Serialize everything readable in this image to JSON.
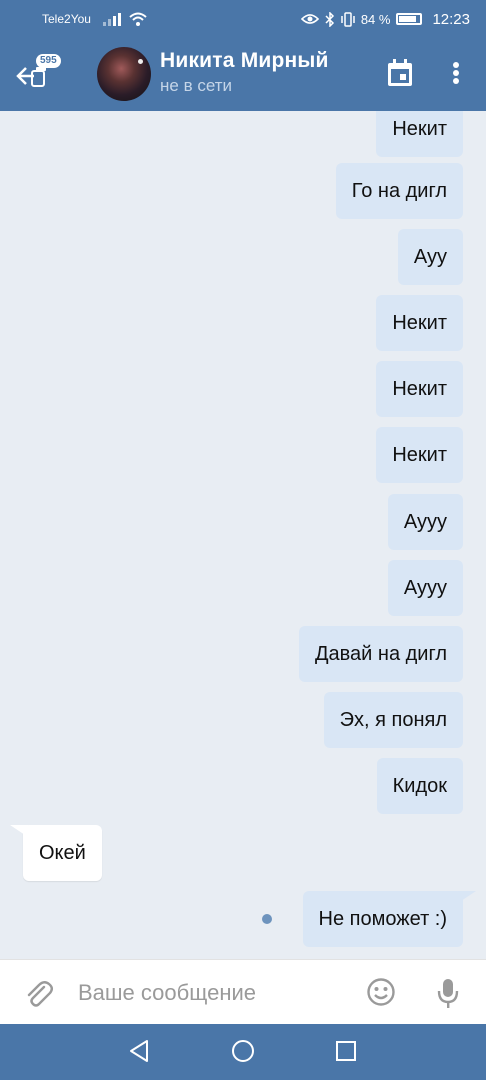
{
  "status_bar": {
    "carrier": "Tele2You",
    "battery": "84 %",
    "battery_level": 0.84,
    "time": "12:23"
  },
  "header": {
    "unread_count": "595",
    "contact_name": "Никита Мирный",
    "contact_status": "не в сети"
  },
  "messages": [
    {
      "dir": "out",
      "text": "Некит"
    },
    {
      "dir": "out",
      "text": "Го на дигл"
    },
    {
      "dir": "out",
      "text": "Ауу"
    },
    {
      "dir": "out",
      "text": "Некит"
    },
    {
      "dir": "out",
      "text": "Некит"
    },
    {
      "dir": "out",
      "text": "Некит"
    },
    {
      "dir": "out",
      "text": "Аууу"
    },
    {
      "dir": "out",
      "text": "Аууу"
    },
    {
      "dir": "out",
      "text": "Давай на дигл"
    },
    {
      "dir": "out",
      "text": "Эх, я понял"
    },
    {
      "dir": "out",
      "text": "Кидок"
    },
    {
      "dir": "in",
      "text": "Окей"
    },
    {
      "dir": "out",
      "text": "Не поможет :)",
      "unread": true
    }
  ],
  "input": {
    "placeholder": "Ваше сообщение"
  },
  "icons": {
    "back": "back-arrow-icon",
    "calendar": "calendar-icon",
    "menu": "more-vertical-icon",
    "attach": "paperclip-icon",
    "emoji": "emoji-icon",
    "mic": "microphone-icon",
    "nav_back": "nav-back-icon",
    "nav_home": "nav-home-icon",
    "nav_recent": "nav-recent-icon"
  },
  "colors": {
    "brand": "#4a76a8",
    "chat_bg": "#e8edf3",
    "outgoing_bubble": "#d9e6f5",
    "incoming_bubble": "#ffffff",
    "unread_dot": "#6d93bd"
  }
}
